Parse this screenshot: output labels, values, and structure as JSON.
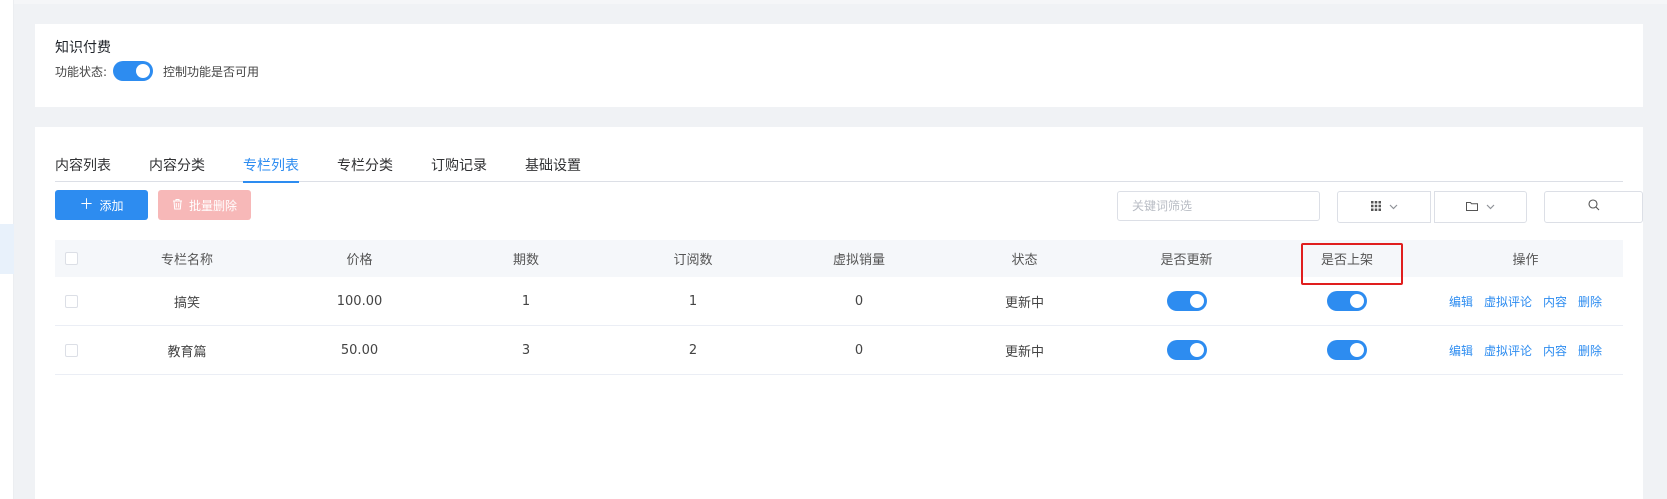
{
  "feature": {
    "title": "知识付费",
    "status_label": "功能状态:",
    "status_desc": "控制功能是否可用",
    "enabled": true
  },
  "tabs": [
    {
      "label": "内容列表",
      "active": false
    },
    {
      "label": "内容分类",
      "active": false
    },
    {
      "label": "专栏列表",
      "active": true
    },
    {
      "label": "专栏分类",
      "active": false
    },
    {
      "label": "订购记录",
      "active": false
    },
    {
      "label": "基础设置",
      "active": false
    }
  ],
  "toolbar": {
    "add_label": "添加",
    "batch_delete_label": "批量删除",
    "search_placeholder": "关键词筛选",
    "icons": [
      "plus-icon",
      "trash-icon",
      "grid-icon",
      "folder-icon",
      "chevron-down-icon",
      "search-icon"
    ]
  },
  "table": {
    "headers": [
      "专栏名称",
      "价格",
      "期数",
      "订阅数",
      "虚拟销量",
      "状态",
      "是否更新",
      "是否上架",
      "操作"
    ],
    "rows": [
      {
        "name": "搞笑",
        "price": "100.00",
        "periods": "1",
        "subscribers": "1",
        "virtual_sales": "0",
        "status": "更新中",
        "updating": true,
        "on_shelf": true
      },
      {
        "name": "教育篇",
        "price": "50.00",
        "periods": "3",
        "subscribers": "2",
        "virtual_sales": "0",
        "status": "更新中",
        "updating": true,
        "on_shelf": true
      }
    ],
    "actions": [
      "编辑",
      "虚拟评论",
      "内容",
      "删除"
    ]
  },
  "colors": {
    "primary": "#2d8cf0",
    "danger_light": "#f7b8b8",
    "highlight": "#e01e1e"
  }
}
